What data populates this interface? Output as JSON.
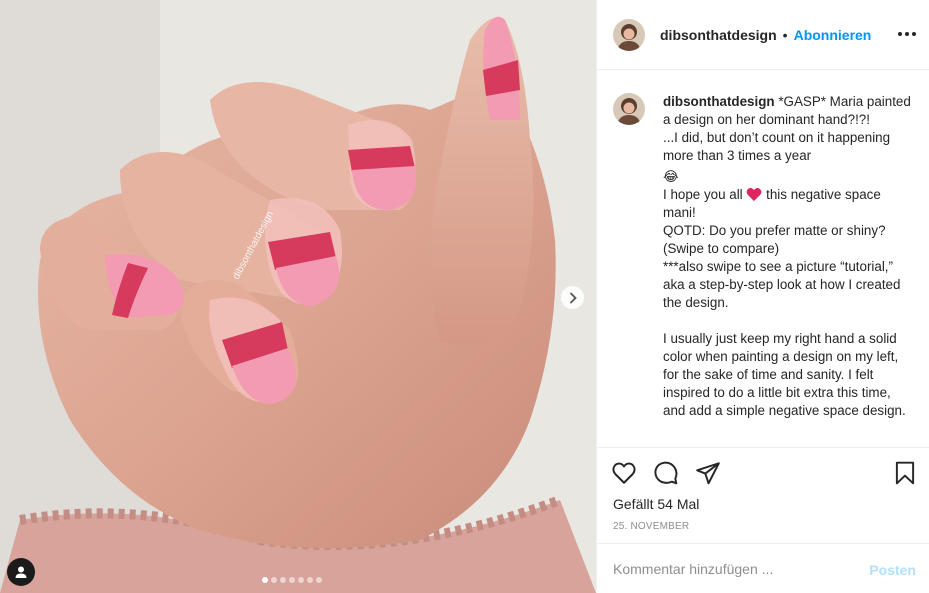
{
  "post": {
    "username": "dibsonthatdesign",
    "separator": "•",
    "follow_label": "Abonnieren",
    "photo_watermark": "dibsonthatdesign",
    "carousel": {
      "total": 7,
      "active": 1
    }
  },
  "caption": {
    "username": "dibsonthatdesign",
    "lines": [
      "*GASP* Maria painted a design on her dominant hand?!?!",
      "...I did, but don’t count on it happening more than 3 times a year",
      "😂",
      "I hope you all",
      "this negative space mani!",
      "QOTD: Do you prefer matte or shiny? (Swipe to compare)",
      "***also swipe to see a picture “tutorial,” aka a step-by-step look at how I created the design.",
      "",
      "I usually just keep my right hand a solid color when painting a design on my left, for the sake of time and sanity. I felt inspired to do a little bit extra this time, and add a simple negative space design."
    ]
  },
  "actions": {
    "likes": "Gefällt 54 Mal",
    "date": "25. NOVEMBER",
    "icons": [
      "heart-icon",
      "comment-icon",
      "share-icon",
      "bookmark-icon"
    ]
  },
  "comment": {
    "placeholder": "Kommentar hinzufügen ...",
    "post_label": "Posten"
  },
  "colors": {
    "accent": "#0095f6",
    "post_disabled": "#b2dffc",
    "nail_pink": "#f49bb4",
    "nail_band": "#d63a5c"
  }
}
